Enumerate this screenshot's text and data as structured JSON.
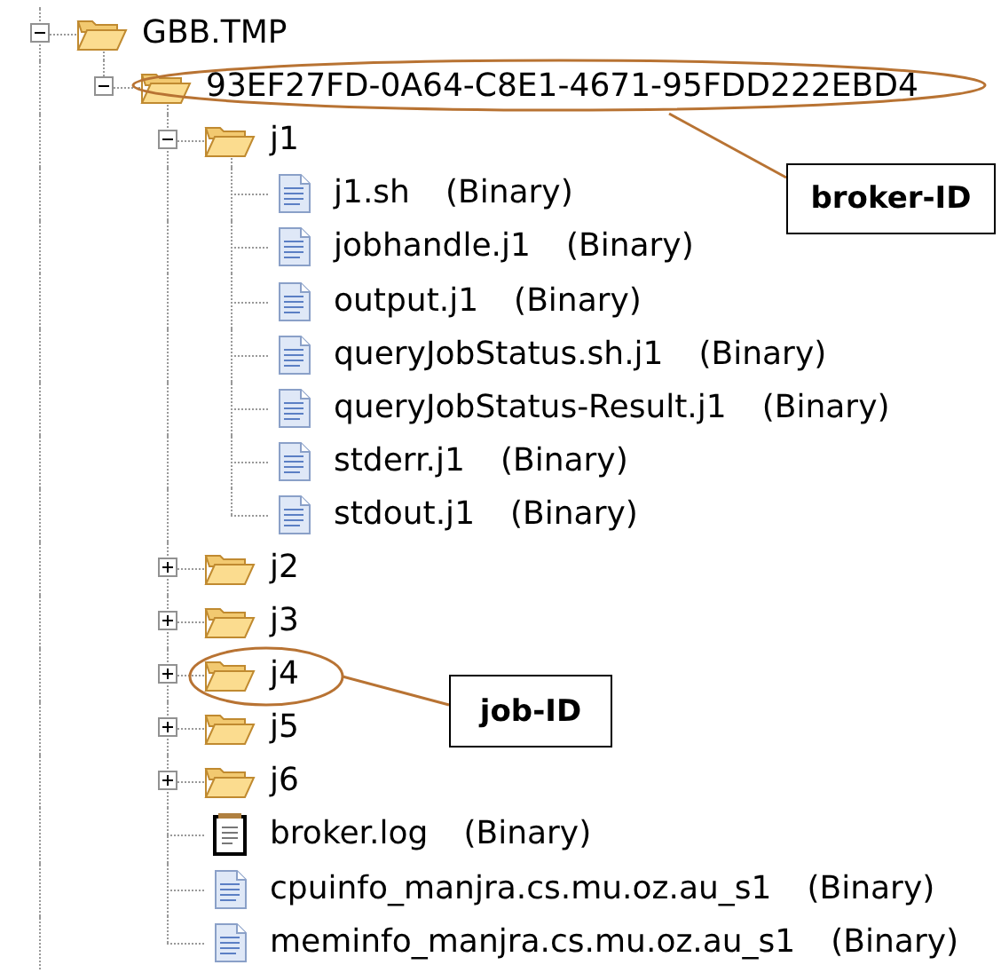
{
  "tree": [
    {
      "label": "GBB.TMP",
      "kind": "folder",
      "expanded": true,
      "children": [
        {
          "label": "93EF27FD-0A64-C8E1-4671-95FDD222EBD4",
          "kind": "folder",
          "expanded": true,
          "children": [
            {
              "label": "j1",
              "kind": "folder",
              "expanded": true,
              "children": [
                {
                  "label": "j1.sh",
                  "kind": "file",
                  "tag": "(Binary)"
                },
                {
                  "label": "jobhandle.j1",
                  "kind": "file",
                  "tag": "(Binary)"
                },
                {
                  "label": "output.j1",
                  "kind": "file",
                  "tag": "(Binary)"
                },
                {
                  "label": "queryJobStatus.sh.j1",
                  "kind": "file",
                  "tag": "(Binary)"
                },
                {
                  "label": "queryJobStatus-Result.j1",
                  "kind": "file",
                  "tag": "(Binary)"
                },
                {
                  "label": "stderr.j1",
                  "kind": "file",
                  "tag": "(Binary)"
                },
                {
                  "label": "stdout.j1",
                  "kind": "file",
                  "tag": "(Binary)"
                }
              ]
            },
            {
              "label": "j2",
              "kind": "folder",
              "expanded": false
            },
            {
              "label": "j3",
              "kind": "folder",
              "expanded": false
            },
            {
              "label": "j4",
              "kind": "folder",
              "expanded": false
            },
            {
              "label": "j5",
              "kind": "folder",
              "expanded": false
            },
            {
              "label": "j6",
              "kind": "folder",
              "expanded": false
            },
            {
              "label": "broker.log",
              "kind": "log",
              "tag": "(Binary)"
            },
            {
              "label": "cpuinfo_manjra.cs.mu.oz.au_s1",
              "kind": "file",
              "tag": "(Binary)"
            },
            {
              "label": "meminfo_manjra.cs.mu.oz.au_s1",
              "kind": "file",
              "tag": "(Binary)"
            }
          ]
        }
      ]
    }
  ],
  "callouts": [
    {
      "label": "broker-ID"
    },
    {
      "label": "job-ID"
    }
  ]
}
